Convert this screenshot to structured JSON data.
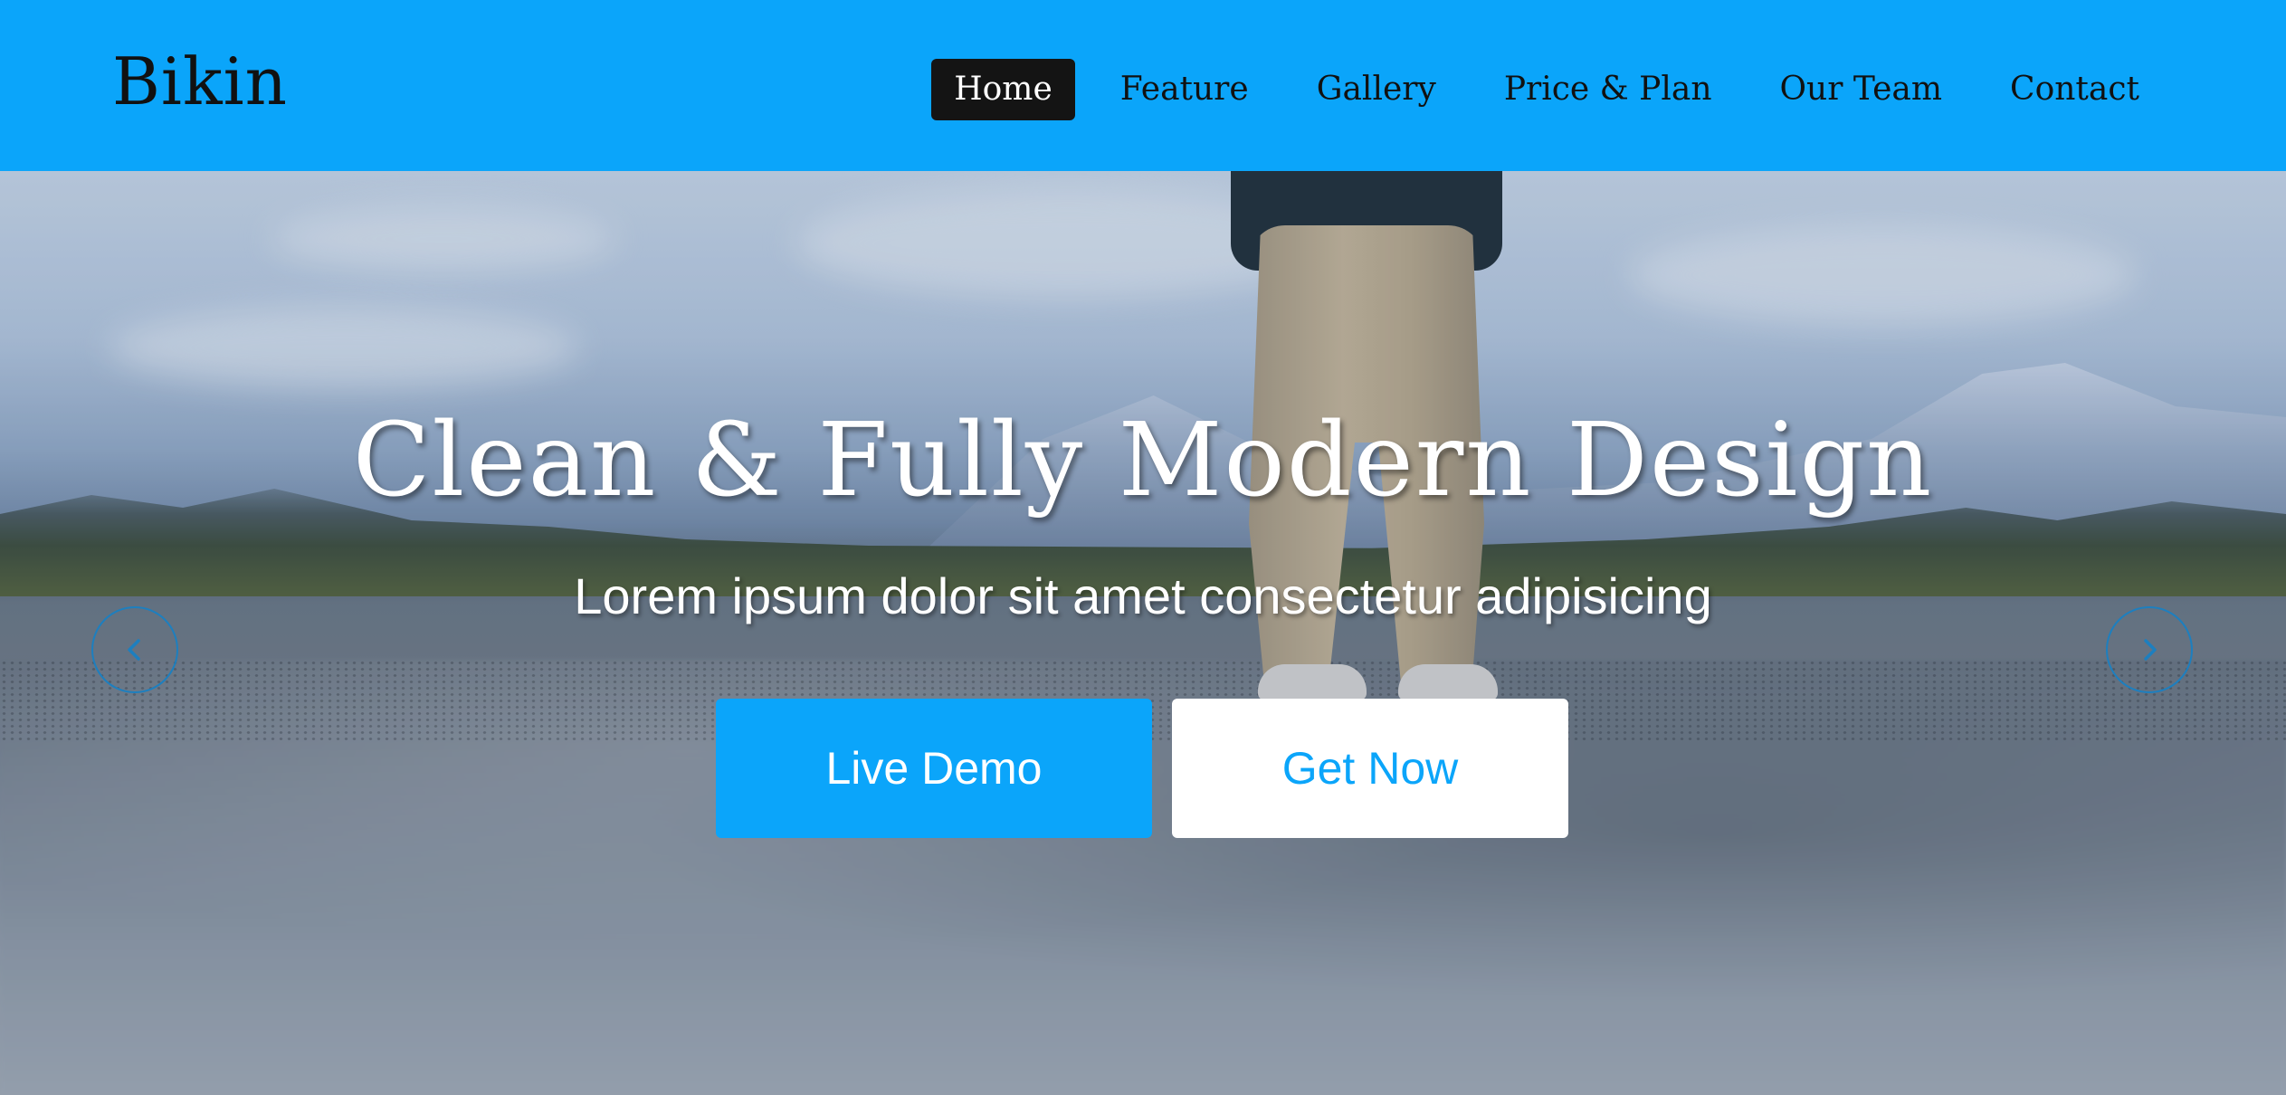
{
  "header": {
    "brand": "Bikin",
    "nav": [
      {
        "label": "Home",
        "active": true
      },
      {
        "label": "Feature",
        "active": false
      },
      {
        "label": "Gallery",
        "active": false
      },
      {
        "label": "Price & Plan",
        "active": false
      },
      {
        "label": "Our Team",
        "active": false
      },
      {
        "label": "Contact",
        "active": false
      }
    ]
  },
  "hero": {
    "title": "Clean & Fully Modern Design",
    "subtitle": "Lorem ipsum dolor sit amet consectetur adipisicing",
    "primary_button": "Live Demo",
    "secondary_button": "Get Now",
    "prev_icon": "chevron-left-icon",
    "next_icon": "chevron-right-icon"
  },
  "colors": {
    "accent": "#0ba5fa",
    "nav_active_bg": "#141414",
    "text_dark": "#111111",
    "white": "#ffffff"
  }
}
